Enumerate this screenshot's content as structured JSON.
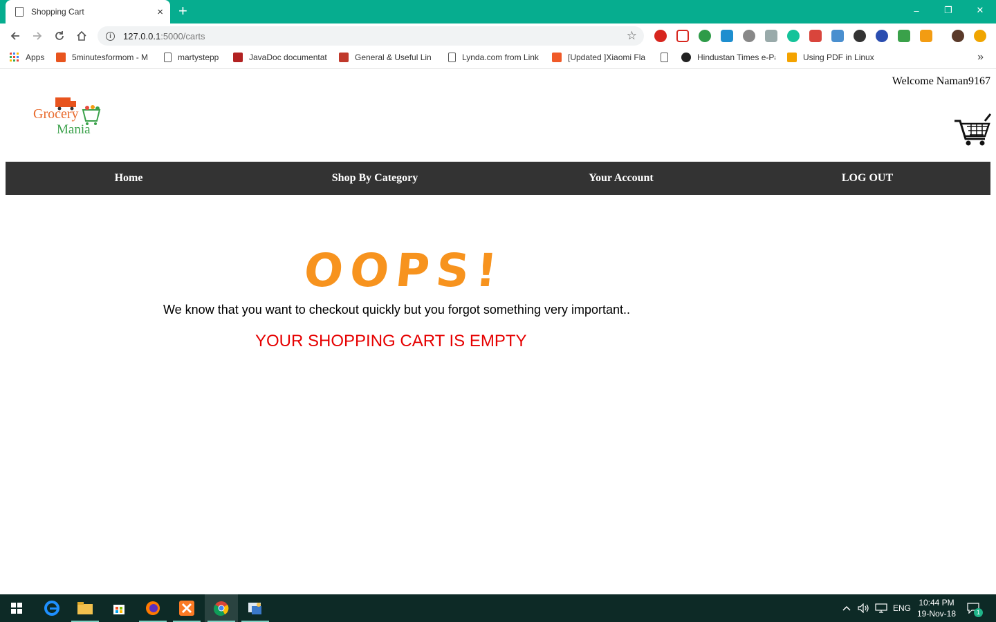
{
  "browser": {
    "tab_title": "Shopping Cart",
    "tab_close": "×",
    "new_tab": "+",
    "url_host": "127.0.0.1",
    "url_rest": ":5000/carts",
    "window_controls": {
      "minimize": "–",
      "restore": "❐",
      "close": "✕"
    }
  },
  "bookmarks": {
    "apps_label": "Apps",
    "items": [
      {
        "label": "5minutesformom - M",
        "color": "#e8541e"
      },
      {
        "label": "martystepp",
        "color": "doc"
      },
      {
        "label": "JavaDoc documentati",
        "color": "#b22222"
      },
      {
        "label": "General & Useful Lin",
        "color": "#c0392b"
      },
      {
        "label": "Lynda.com from Link",
        "color": "doc"
      },
      {
        "label": "[Updated ]Xiaomi Fla",
        "color": "#f05a28"
      },
      {
        "label": "",
        "color": "doc"
      },
      {
        "label": "Hindustan Times e-Pa",
        "color": "#222"
      },
      {
        "label": "Using PDF in Linux",
        "color": "#f4a300"
      }
    ],
    "more": "»"
  },
  "page": {
    "welcome": "Welcome Naman9167",
    "logo": {
      "word1": "Grocery",
      "word2": "Mania"
    },
    "nav": [
      "Home",
      "Shop By Category",
      "Your Account",
      "LOG OUT"
    ],
    "oops": "OOPS!",
    "message": "We know that you want to checkout quickly but you forgot something very important..",
    "empty": "YOUR SHOPPING CART IS EMPTY",
    "colors": {
      "oops": "#f7931e",
      "empty": "#e60000",
      "nav_bg": "#333333"
    }
  },
  "taskbar": {
    "lang": "ENG",
    "time": "10:44 PM",
    "date": "19-Nov-18",
    "notifications": "1"
  }
}
